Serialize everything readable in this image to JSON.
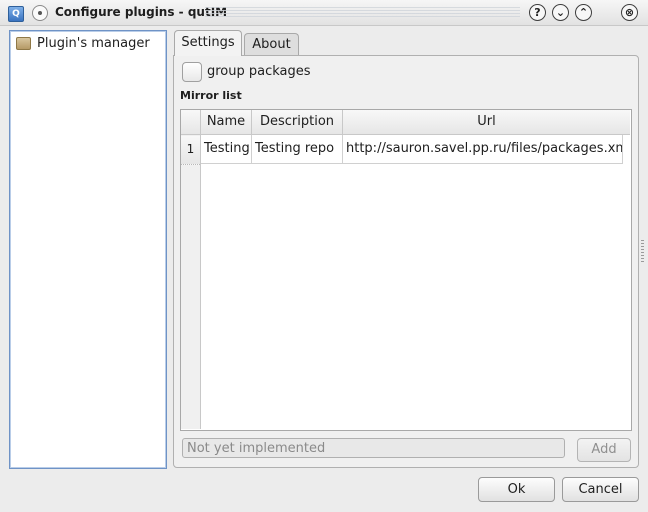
{
  "window": {
    "title": "Configure plugins - qutIM",
    "app_icon_letter": "Q",
    "buttons": {
      "help": "?",
      "minimize": "⌄",
      "maximize": "⌃",
      "close": "⊗"
    }
  },
  "sidebar": {
    "items": [
      {
        "label": "Plugin's manager",
        "icon": "folder-icon"
      }
    ]
  },
  "tabs": [
    {
      "label": "Settings",
      "active": true
    },
    {
      "label": "About",
      "active": false
    }
  ],
  "settings": {
    "group_packages": {
      "label": "group packages",
      "checked": false
    },
    "mirror_list_label": "Mirror list",
    "table": {
      "columns": [
        "Name",
        "Description",
        "Url"
      ],
      "rows": [
        {
          "num": "1",
          "name": "Testing",
          "description": "Testing repo",
          "url": "http://sauron.savel.pp.ru/files/packages.xml"
        }
      ]
    },
    "input_placeholder": "Not yet implemented",
    "add_label": "Add"
  },
  "dialog": {
    "ok_label": "Ok",
    "cancel_label": "Cancel"
  }
}
